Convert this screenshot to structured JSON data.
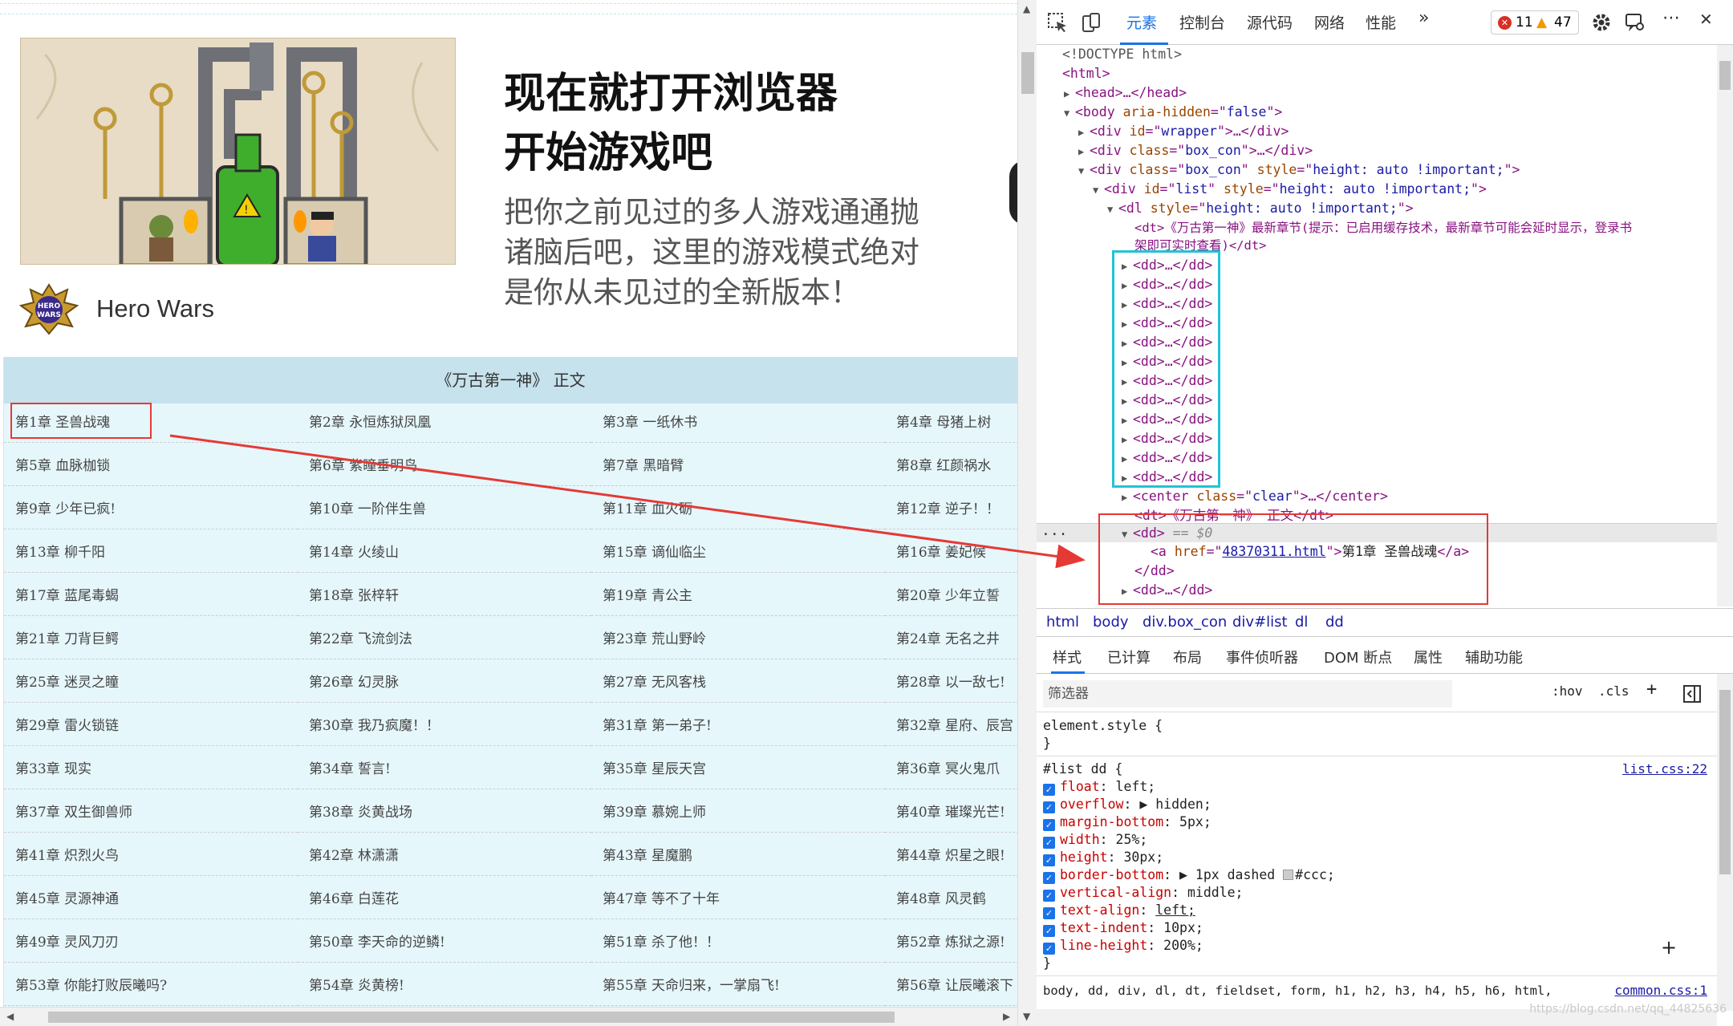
{
  "ad": {
    "heading_line1": "现在就打开浏览器",
    "heading_line2": "开始游戏吧",
    "body_line1": "把你之前见过的多人游戏通通抛",
    "body_line2": "诸脑后吧，这里的游戏模式绝对",
    "body_line3": "是你从未见过的全新版本！",
    "brand": "Hero Wars",
    "logo_text1": "HERO",
    "logo_text2": "WARS"
  },
  "list": {
    "title": "《万古第一神》  正文",
    "chapters": [
      "第1章 圣兽战魂",
      "第2章 永恒炼狱凤凰",
      "第3章 一纸休书",
      "第4章 母猪上树",
      "第5章 血脉枷锁",
      "第6章 紫瞳垂明鸟",
      "第7章 黑暗臂",
      "第8章 红颜祸水",
      "第9章 少年已疯!",
      "第10章 一阶伴生兽",
      "第11章 血火砺",
      "第12章 逆子！！",
      "第13章 柳千阳",
      "第14章 火绫山",
      "第15章 谪仙临尘",
      "第16章 姜妃候",
      "第17章 蓝尾毒蝎",
      "第18章 张梓轩",
      "第19章 青公主",
      "第20章 少年立誓",
      "第21章 刀背巨鳄",
      "第22章 飞流剑法",
      "第23章 荒山野岭",
      "第24章 无名之井",
      "第25章 迷灵之瞳",
      "第26章 幻灵脉",
      "第27章 无风客栈",
      "第28章 以一敌七!",
      "第29章 雷火锁链",
      "第30章 我乃疯魔！！",
      "第31章 第一弟子!",
      "第32章 星府、辰宫",
      "第33章 现实",
      "第34章 誓言!",
      "第35章 星辰天宫",
      "第36章 冥火鬼爪",
      "第37章 双生御兽师",
      "第38章 炎黄战场",
      "第39章 慕婉上师",
      "第40章 璀璨光芒!",
      "第41章 炽烈火鸟",
      "第42章 林潇潇",
      "第43章 星魔鹏",
      "第44章 炽星之眼!",
      "第45章 灵源神通",
      "第46章 白莲花",
      "第47章 等不了十年",
      "第48章 风灵鹤",
      "第49章 灵风刀刃",
      "第50章 李天命的逆鳞!",
      "第51章 杀了他！！",
      "第52章 炼狱之源!",
      "第53章 你能打败辰曦吗?",
      "第54章 炎黄榜!",
      "第55章 天命归来，一掌扇飞!",
      "第56章 让辰曦滚下"
    ]
  },
  "devtools": {
    "tabs": [
      "元素",
      "控制台",
      "源代码",
      "网络",
      "性能"
    ],
    "more_tabs": "»",
    "errors": "11",
    "warnings": "47",
    "menu": "⋯",
    "close": "✕",
    "dom": {
      "doctype": "<!DOCTYPE html>",
      "html_open": "<html>",
      "head": "<head>…</head>",
      "body": [
        "<body ",
        "aria-hidden",
        "=\"",
        "false",
        "\">"
      ],
      "wrapper": [
        "<div ",
        "id",
        "=\"",
        "wrapper",
        "\">…</div>"
      ],
      "boxcon1": [
        "<div ",
        "class",
        "=\"",
        "box_con",
        "\">…</div>"
      ],
      "boxcon2": [
        "<div ",
        "class",
        "=\"",
        "box_con",
        "\" ",
        "style",
        "=\"",
        "height: auto !important;",
        "\">"
      ],
      "list": [
        "<div ",
        "id",
        "=\"",
        "list",
        "\" ",
        "style",
        "=\"",
        "height: auto !important;",
        "\">"
      ],
      "dl": [
        "<dl ",
        "style",
        "=\"",
        "height: auto !important;",
        "\">"
      ],
      "dt1_line1": "<dt>《万古第一神》最新章节(提示：已启用缓存技术，最新章节可能会延时显示，登录书",
      "dt1_line2": "架即可实时查看)</dt>",
      "dd_collapsed": "<dd>…</dd>",
      "center": [
        "<center ",
        "class",
        "=\"",
        "clear",
        "\">…</center>"
      ],
      "dt2": "<dt>《万古第一神》 正文</dt>",
      "dd_open": "<dd>",
      "dd_sel_marker": " == $0",
      "a_open": "<a ",
      "a_attr": "href",
      "a_val": "48370311.html",
      "a_text": "第1章 圣兽战魂",
      "a_close": "</a>",
      "dd_close": "</dd>",
      "ellipsis": "..."
    },
    "breadcrumbs": [
      "html",
      "body",
      "div.box_con",
      "div#list",
      "dl",
      "dd"
    ],
    "panel_tabs": [
      "样式",
      "已计算",
      "布局",
      "事件侦听器",
      "DOM 断点",
      "属性",
      "辅助功能"
    ],
    "filter_placeholder": "筛选器",
    "hov": ":hov",
    "cls": ".cls",
    "plus": "+",
    "element_style": "element.style {",
    "close_brace": "}",
    "rule_selector": "#list dd {",
    "rule_source": "list.css:22",
    "props": [
      {
        "name": "float",
        "value": "left;"
      },
      {
        "name": "overflow",
        "value": "▶ hidden;"
      },
      {
        "name": "margin-bottom",
        "value": "5px;"
      },
      {
        "name": "width",
        "value": "25%;"
      },
      {
        "name": "height",
        "value": "30px;"
      },
      {
        "name": "border-bottom",
        "value": "▶ 1px dashed "
      },
      {
        "name": "vertical-align",
        "value": "middle;"
      },
      {
        "name": "text-align",
        "value": "left;"
      },
      {
        "name": "text-indent",
        "value": "10px;"
      },
      {
        "name": "line-height",
        "value": "200%;"
      }
    ],
    "border_color": "#ccc;",
    "reset_selector": "body, dd, div, dl, dt, fieldset, form, h1, h2, h3, h4, h5, h6, html,",
    "reset_source": "common.css:1",
    "watermark": "https://blog.csdn.net/qq_44825636"
  },
  "colors": {
    "accent": "#1a73e8",
    "annotation_red": "#e53935",
    "annotation_cyan": "#22c3d6",
    "list_bg": "#e6f7fb"
  }
}
